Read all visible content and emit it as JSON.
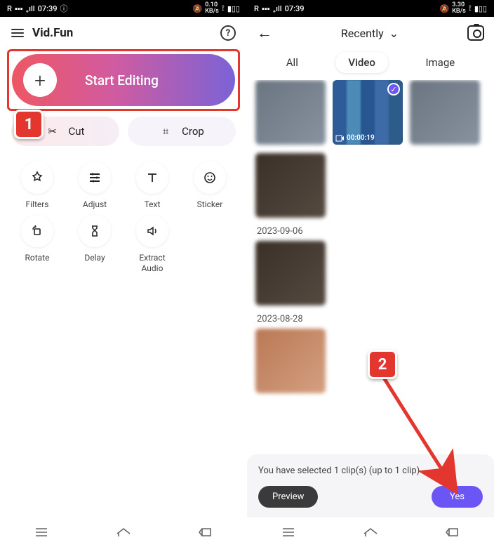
{
  "status": {
    "time": "07:39",
    "carrier": "R",
    "data_rate": "0.10",
    "data_rate2": "3.30",
    "data_unit": "KB/s"
  },
  "left": {
    "app_title": "Vid.Fun",
    "start_label": "Start Editing",
    "cut": "Cut",
    "crop": "Crop",
    "tools": [
      {
        "label": "Filters",
        "icon": "✦"
      },
      {
        "label": "Adjust",
        "icon": "☰"
      },
      {
        "label": "Text",
        "icon": "T"
      },
      {
        "label": "Sticker",
        "icon": "☺"
      },
      {
        "label": "Rotate",
        "icon": "◻"
      },
      {
        "label": "Delay",
        "icon": "⧗"
      },
      {
        "label": "Extract\nAudio",
        "icon": "🔈"
      }
    ]
  },
  "right": {
    "picker_title": "Recently",
    "tab_all": "All",
    "tab_video": "Video",
    "tab_image": "Image",
    "selected_duration": "00:00:19",
    "date1": "2023-09-06",
    "date2": "2023-08-28",
    "sheet_text": "You have selected 1 clip(s) (up to 1 clip)",
    "preview": "Preview",
    "yes": "Yes"
  },
  "annotations": {
    "one": "1",
    "two": "2"
  }
}
